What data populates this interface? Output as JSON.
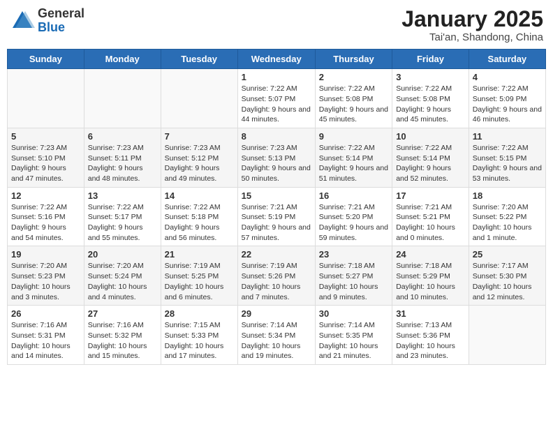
{
  "header": {
    "logo_general": "General",
    "logo_blue": "Blue",
    "month_title": "January 2025",
    "subtitle": "Tai'an, Shandong, China"
  },
  "days_of_week": [
    "Sunday",
    "Monday",
    "Tuesday",
    "Wednesday",
    "Thursday",
    "Friday",
    "Saturday"
  ],
  "weeks": [
    [
      {
        "day": "",
        "info": ""
      },
      {
        "day": "",
        "info": ""
      },
      {
        "day": "",
        "info": ""
      },
      {
        "day": "1",
        "info": "Sunrise: 7:22 AM\nSunset: 5:07 PM\nDaylight: 9 hours\nand 44 minutes."
      },
      {
        "day": "2",
        "info": "Sunrise: 7:22 AM\nSunset: 5:08 PM\nDaylight: 9 hours\nand 45 minutes."
      },
      {
        "day": "3",
        "info": "Sunrise: 7:22 AM\nSunset: 5:08 PM\nDaylight: 9 hours\nand 45 minutes."
      },
      {
        "day": "4",
        "info": "Sunrise: 7:22 AM\nSunset: 5:09 PM\nDaylight: 9 hours\nand 46 minutes."
      }
    ],
    [
      {
        "day": "5",
        "info": "Sunrise: 7:23 AM\nSunset: 5:10 PM\nDaylight: 9 hours\nand 47 minutes."
      },
      {
        "day": "6",
        "info": "Sunrise: 7:23 AM\nSunset: 5:11 PM\nDaylight: 9 hours\nand 48 minutes."
      },
      {
        "day": "7",
        "info": "Sunrise: 7:23 AM\nSunset: 5:12 PM\nDaylight: 9 hours\nand 49 minutes."
      },
      {
        "day": "8",
        "info": "Sunrise: 7:23 AM\nSunset: 5:13 PM\nDaylight: 9 hours\nand 50 minutes."
      },
      {
        "day": "9",
        "info": "Sunrise: 7:22 AM\nSunset: 5:14 PM\nDaylight: 9 hours\nand 51 minutes."
      },
      {
        "day": "10",
        "info": "Sunrise: 7:22 AM\nSunset: 5:14 PM\nDaylight: 9 hours\nand 52 minutes."
      },
      {
        "day": "11",
        "info": "Sunrise: 7:22 AM\nSunset: 5:15 PM\nDaylight: 9 hours\nand 53 minutes."
      }
    ],
    [
      {
        "day": "12",
        "info": "Sunrise: 7:22 AM\nSunset: 5:16 PM\nDaylight: 9 hours\nand 54 minutes."
      },
      {
        "day": "13",
        "info": "Sunrise: 7:22 AM\nSunset: 5:17 PM\nDaylight: 9 hours\nand 55 minutes."
      },
      {
        "day": "14",
        "info": "Sunrise: 7:22 AM\nSunset: 5:18 PM\nDaylight: 9 hours\nand 56 minutes."
      },
      {
        "day": "15",
        "info": "Sunrise: 7:21 AM\nSunset: 5:19 PM\nDaylight: 9 hours\nand 57 minutes."
      },
      {
        "day": "16",
        "info": "Sunrise: 7:21 AM\nSunset: 5:20 PM\nDaylight: 9 hours\nand 59 minutes."
      },
      {
        "day": "17",
        "info": "Sunrise: 7:21 AM\nSunset: 5:21 PM\nDaylight: 10 hours\nand 0 minutes."
      },
      {
        "day": "18",
        "info": "Sunrise: 7:20 AM\nSunset: 5:22 PM\nDaylight: 10 hours\nand 1 minute."
      }
    ],
    [
      {
        "day": "19",
        "info": "Sunrise: 7:20 AM\nSunset: 5:23 PM\nDaylight: 10 hours\nand 3 minutes."
      },
      {
        "day": "20",
        "info": "Sunrise: 7:20 AM\nSunset: 5:24 PM\nDaylight: 10 hours\nand 4 minutes."
      },
      {
        "day": "21",
        "info": "Sunrise: 7:19 AM\nSunset: 5:25 PM\nDaylight: 10 hours\nand 6 minutes."
      },
      {
        "day": "22",
        "info": "Sunrise: 7:19 AM\nSunset: 5:26 PM\nDaylight: 10 hours\nand 7 minutes."
      },
      {
        "day": "23",
        "info": "Sunrise: 7:18 AM\nSunset: 5:27 PM\nDaylight: 10 hours\nand 9 minutes."
      },
      {
        "day": "24",
        "info": "Sunrise: 7:18 AM\nSunset: 5:29 PM\nDaylight: 10 hours\nand 10 minutes."
      },
      {
        "day": "25",
        "info": "Sunrise: 7:17 AM\nSunset: 5:30 PM\nDaylight: 10 hours\nand 12 minutes."
      }
    ],
    [
      {
        "day": "26",
        "info": "Sunrise: 7:16 AM\nSunset: 5:31 PM\nDaylight: 10 hours\nand 14 minutes."
      },
      {
        "day": "27",
        "info": "Sunrise: 7:16 AM\nSunset: 5:32 PM\nDaylight: 10 hours\nand 15 minutes."
      },
      {
        "day": "28",
        "info": "Sunrise: 7:15 AM\nSunset: 5:33 PM\nDaylight: 10 hours\nand 17 minutes."
      },
      {
        "day": "29",
        "info": "Sunrise: 7:14 AM\nSunset: 5:34 PM\nDaylight: 10 hours\nand 19 minutes."
      },
      {
        "day": "30",
        "info": "Sunrise: 7:14 AM\nSunset: 5:35 PM\nDaylight: 10 hours\nand 21 minutes."
      },
      {
        "day": "31",
        "info": "Sunrise: 7:13 AM\nSunset: 5:36 PM\nDaylight: 10 hours\nand 23 minutes."
      },
      {
        "day": "",
        "info": ""
      }
    ]
  ]
}
